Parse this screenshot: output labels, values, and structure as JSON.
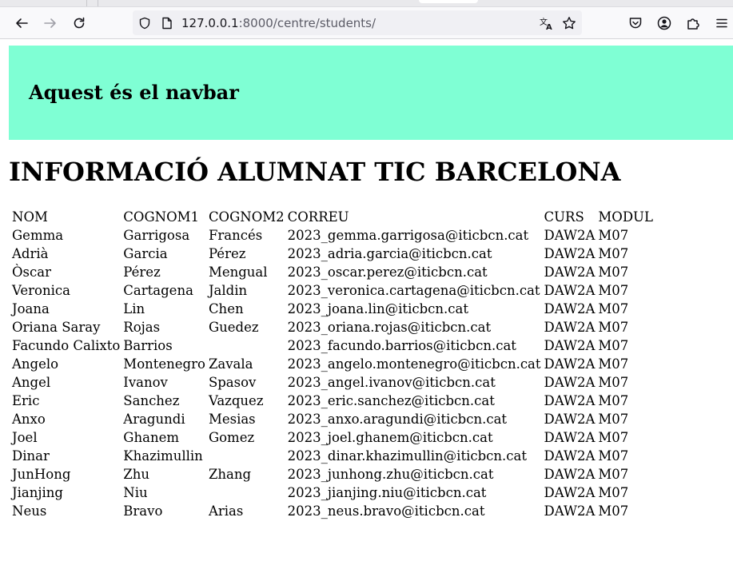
{
  "browser": {
    "url_host": "127.0.0.1",
    "url_rest": ":8000/centre/students/"
  },
  "navbar": {
    "title": "Aquest és el navbar"
  },
  "page": {
    "heading": "INFORMACIÓ ALUMNAT TIC BARCELONA"
  },
  "table": {
    "headers": [
      "NOM",
      "COGNOM1",
      "COGNOM2",
      "CORREU",
      "CURS",
      "MODUL"
    ],
    "rows": [
      [
        "Gemma",
        "Garrigosa",
        "Francés",
        "2023_gemma.garrigosa@iticbcn.cat",
        "DAW2A",
        "M07"
      ],
      [
        "Adrià",
        "Garcia",
        "Pérez",
        "2023_adria.garcia@iticbcn.cat",
        "DAW2A",
        "M07"
      ],
      [
        "Òscar",
        "Pérez",
        "Mengual",
        "2023_oscar.perez@iticbcn.cat",
        "DAW2A",
        "M07"
      ],
      [
        "Veronica",
        "Cartagena",
        "Jaldin",
        "2023_veronica.cartagena@iticbcn.cat",
        "DAW2A",
        "M07"
      ],
      [
        "Joana",
        "Lin",
        "Chen",
        "2023_joana.lin@iticbcn.cat",
        "DAW2A",
        "M07"
      ],
      [
        "Oriana Saray",
        "Rojas",
        "Guedez",
        "2023_oriana.rojas@iticbcn.cat",
        "DAW2A",
        "M07"
      ],
      [
        "Facundo Calixto",
        "Barrios",
        "",
        "2023_facundo.barrios@iticbcn.cat",
        "DAW2A",
        "M07"
      ],
      [
        "Angelo",
        "Montenegro",
        "Zavala",
        "2023_angelo.montenegro@iticbcn.cat",
        "DAW2A",
        "M07"
      ],
      [
        "Angel",
        "Ivanov",
        "Spasov",
        "2023_angel.ivanov@iticbcn.cat",
        "DAW2A",
        "M07"
      ],
      [
        "Eric",
        "Sanchez",
        "Vazquez",
        "2023_eric.sanchez@iticbcn.cat",
        "DAW2A",
        "M07"
      ],
      [
        "Anxo",
        "Aragundi",
        "Mesias",
        "2023_anxo.aragundi@iticbcn.cat",
        "DAW2A",
        "M07"
      ],
      [
        "Joel",
        "Ghanem",
        "Gomez",
        "2023_joel.ghanem@iticbcn.cat",
        "DAW2A",
        "M07"
      ],
      [
        "Dinar",
        "Khazimullin",
        "",
        "2023_dinar.khazimullin@iticbcn.cat",
        "DAW2A",
        "M07"
      ],
      [
        "JunHong",
        "Zhu",
        "Zhang",
        "2023_junhong.zhu@iticbcn.cat",
        "DAW2A",
        "M07"
      ],
      [
        "Jianjing",
        "Niu",
        "",
        "2023_jianjing.niu@iticbcn.cat",
        "DAW2A",
        "M07"
      ],
      [
        "Neus",
        "Bravo",
        "Arias",
        "2023_neus.bravo@iticbcn.cat",
        "DAW2A",
        "M07"
      ]
    ]
  },
  "icons": {
    "back": "back-arrow-icon",
    "forward": "forward-arrow-icon",
    "reload": "reload-icon",
    "site_info": "shield-icon",
    "page": "page-icon",
    "translate": "translate-icon",
    "bookmark": "star-icon",
    "pocket": "pocket-icon",
    "account": "account-icon",
    "extensions": "extensions-icon",
    "menu": "menu-icon"
  },
  "colors": {
    "navbar_background": "#7fffd4",
    "toolbar_background": "#f9f9fb",
    "urlbar_background": "#f0f0f4"
  }
}
